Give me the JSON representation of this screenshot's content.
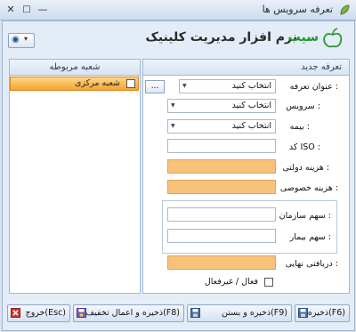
{
  "window": {
    "title": "تعرفه سرویس ها"
  },
  "titlebar_buttons": {
    "close": "✕",
    "maximize": "□",
    "minimize": "—"
  },
  "toolbar": {
    "chip_icon": "help-globe-icon",
    "chip_glyph": "◉",
    "chip_arrow": "▾"
  },
  "logo": {
    "text": "نرم افزار مدیریت کلینیک",
    "accent": "سیب",
    "accent_color": "#1a9a2a"
  },
  "left_panel": {
    "header": "شعبه مربوطه",
    "rows": [
      {
        "label": "شعبه مرکزی",
        "checked": false
      }
    ]
  },
  "right_panel": {
    "header": "تعرفه جدید",
    "ellipsis": "...",
    "fields": {
      "tariff_title": {
        "label": "عنوان تعرفه :",
        "value": "انتخاب کنید"
      },
      "service": {
        "label": "سرویس :",
        "value": "انتخاب کنید"
      },
      "insurance": {
        "label": "بیمه :",
        "value": "انتخاب کنید"
      },
      "iso_code": {
        "label": "کد ISO :",
        "value": ""
      },
      "gov_cost": {
        "label": "هزینه دولتی :",
        "value": ""
      },
      "private_cost": {
        "label": "هزینه خصوصی :",
        "value": ""
      },
      "org_share": {
        "label": "سهم سازمان :",
        "value": ""
      },
      "patient_share": {
        "label": "سهم بیمار :",
        "value": ""
      },
      "final_receipt": {
        "label": "دریافتی نهایی :",
        "value": ""
      },
      "active": {
        "label": "فعال / غیرفعال",
        "checked": false
      }
    }
  },
  "footer": {
    "save": "ذخیره(F6)",
    "save_close": "ذخیره و بستن(F9)",
    "save_discount": "ذخیره و اعمال تخفیف(F8)",
    "exit": "خروج(Esc)"
  },
  "colors": {
    "highlight": "#f5a431",
    "orange_field": "#f8c27b",
    "panel_border": "#a2b8d6"
  }
}
